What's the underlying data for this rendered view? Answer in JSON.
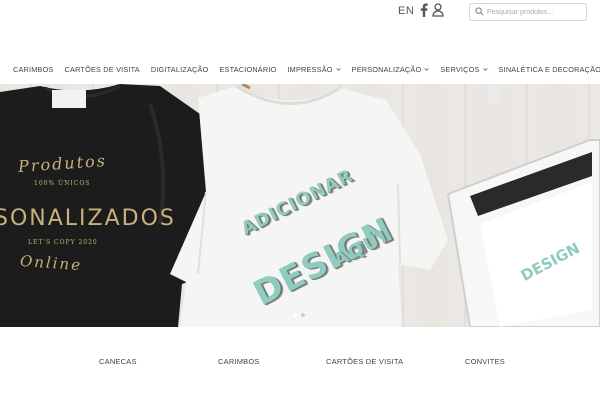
{
  "header": {
    "language": "EN",
    "search": {
      "placeholder": "Pesquisar produtos..."
    }
  },
  "nav": {
    "items": [
      {
        "label": "CARIMBOS",
        "dropdown": false
      },
      {
        "label": "CARTÕES DE VISITA",
        "dropdown": false
      },
      {
        "label": "DIGITALIZAÇÃO",
        "dropdown": false
      },
      {
        "label": "ESTACIONÁRIO",
        "dropdown": false
      },
      {
        "label": "IMPRESSÃO",
        "dropdown": true
      },
      {
        "label": "PERSONALIZAÇÃO",
        "dropdown": true
      },
      {
        "label": "SERVIÇOS",
        "dropdown": true
      },
      {
        "label": "SINALÉTICA E DECORAÇÃO",
        "dropdown": true
      }
    ]
  },
  "banner": {
    "black_shirt": {
      "line1": "Produtos",
      "line2": "100% ÚNICOS",
      "line3": "SONALIZADOS",
      "line4": "LET'S COPY 2020",
      "line5": "Online"
    },
    "white_shirt": {
      "line1": "ADICIONAR",
      "line2": "DESIGN",
      "line3": "AQUI"
    },
    "tablet_design": "DESIGN",
    "slides_total": 2,
    "slide_active": 1
  },
  "categories": [
    "CANECAS",
    "CARIMBOS",
    "CARTÕES DE VISITA",
    "CONVITES"
  ],
  "colors": {
    "gold_print": "#c7b27a",
    "teal_print": "#8fcbbf",
    "shirt_black": "#1c1c1c",
    "nav_text": "#444444"
  }
}
